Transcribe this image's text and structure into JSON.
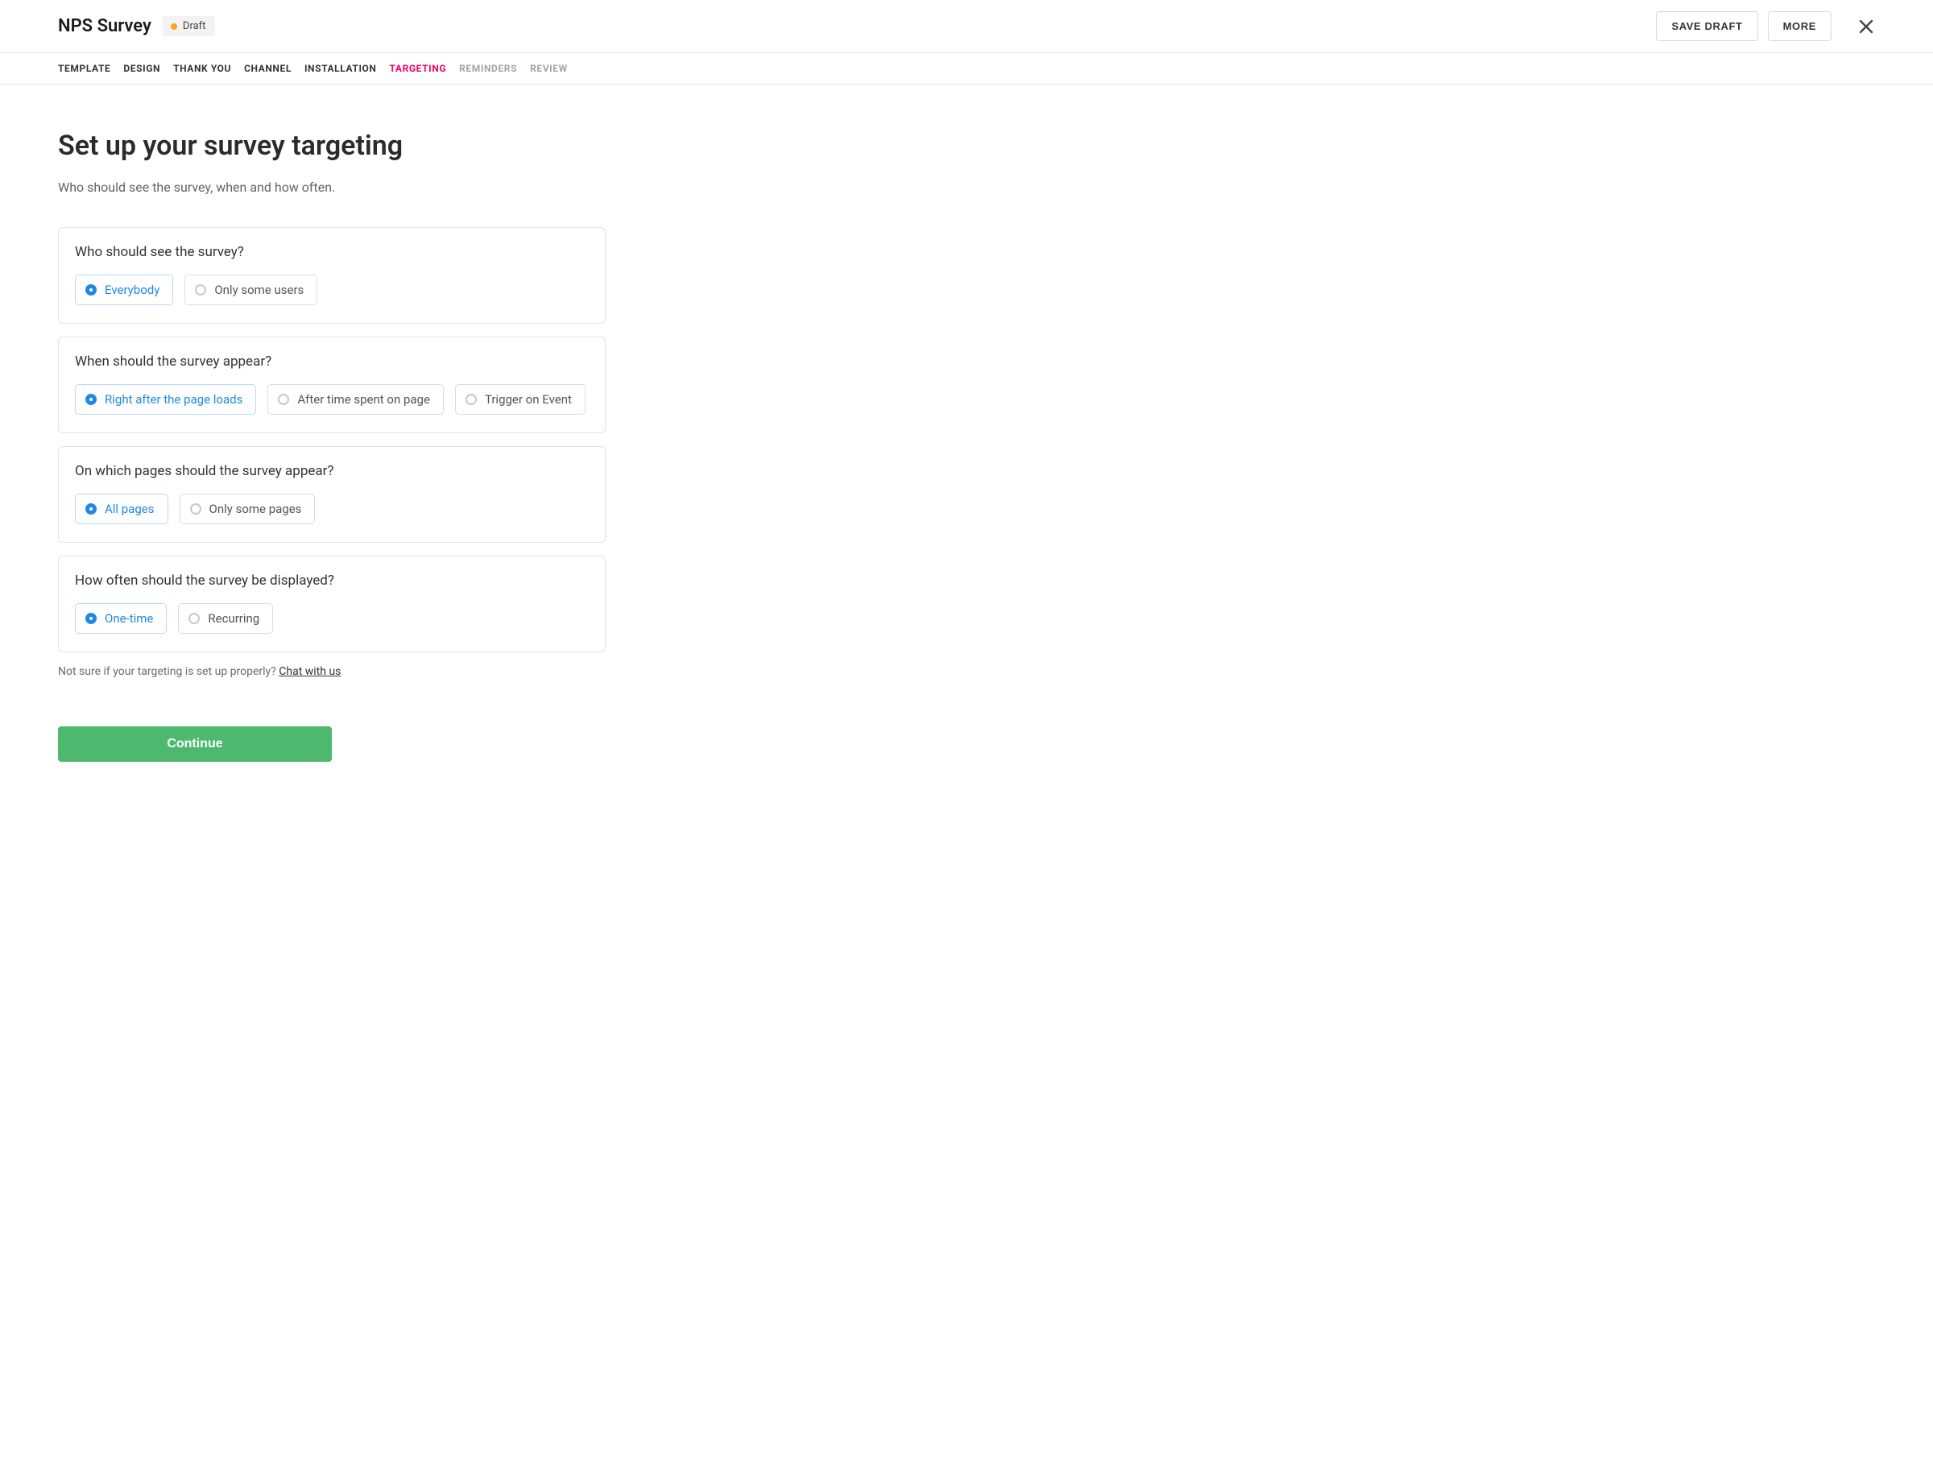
{
  "header": {
    "title": "NPS Survey",
    "status": "Draft",
    "save_label": "SAVE DRAFT",
    "more_label": "MORE"
  },
  "tabs": [
    {
      "label": "TEMPLATE",
      "state": "normal"
    },
    {
      "label": "DESIGN",
      "state": "normal"
    },
    {
      "label": "THANK YOU",
      "state": "normal"
    },
    {
      "label": "CHANNEL",
      "state": "normal"
    },
    {
      "label": "INSTALLATION",
      "state": "normal"
    },
    {
      "label": "TARGETING",
      "state": "active"
    },
    {
      "label": "REMINDERS",
      "state": "disabled"
    },
    {
      "label": "REVIEW",
      "state": "disabled"
    }
  ],
  "main": {
    "heading": "Set up your survey targeting",
    "subheading": "Who should see the survey, when and how often."
  },
  "sections": [
    {
      "question": "Who should see the survey?",
      "options": [
        {
          "label": "Everybody",
          "selected": true
        },
        {
          "label": "Only some users",
          "selected": false
        }
      ]
    },
    {
      "question": "When should the survey appear?",
      "options": [
        {
          "label": "Right after the page loads",
          "selected": true
        },
        {
          "label": "After time spent on page",
          "selected": false
        },
        {
          "label": "Trigger on Event",
          "selected": false
        }
      ]
    },
    {
      "question": "On which pages should the survey appear?",
      "options": [
        {
          "label": "All pages",
          "selected": true
        },
        {
          "label": "Only some pages",
          "selected": false
        }
      ]
    },
    {
      "question": "How often should the survey be displayed?",
      "options": [
        {
          "label": "One-time",
          "selected": true
        },
        {
          "label": "Recurring",
          "selected": false
        }
      ]
    }
  ],
  "help": {
    "text": "Not sure if your targeting is set up properly? ",
    "link": "Chat with us"
  },
  "continue_label": "Continue"
}
